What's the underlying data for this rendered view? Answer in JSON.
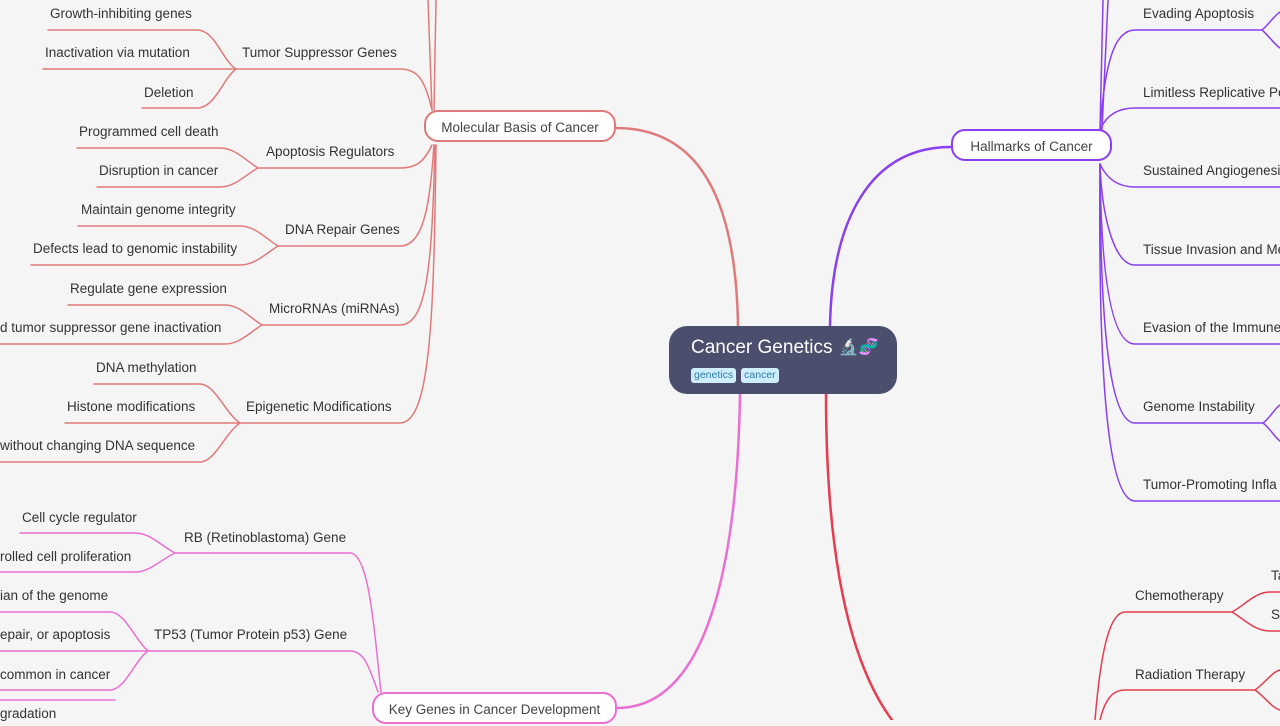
{
  "root": {
    "title": "Cancer Genetics",
    "emoji": "🔬🧬",
    "tags": [
      "genetics",
      "cancer"
    ]
  },
  "colors": {
    "background": "#f5f5f5",
    "root_fill": "#4b4e6d",
    "molecular": "#e07a7a",
    "hallmarks": "#8a3ff0",
    "key_genes": "#ea6fd3",
    "treatment": "#e63c4e",
    "tag_bg": "#cdeefa",
    "tag_text": "#2d7ea3"
  },
  "branches": {
    "molecular": {
      "label": "Molecular Basis of Cancer",
      "children": [
        {
          "label": "Tumor Suppressor Genes",
          "children": [
            "Growth-inhibiting genes",
            "Inactivation via mutation",
            "Deletion"
          ]
        },
        {
          "label": "Apoptosis Regulators",
          "children": [
            "Programmed cell death",
            "Disruption in cancer"
          ]
        },
        {
          "label": "DNA Repair Genes",
          "children": [
            "Maintain genome integrity",
            "Defects lead to genomic instability"
          ]
        },
        {
          "label": "MicroRNAs (miRNAs)",
          "children": [
            "Regulate gene expression",
            "d tumor suppressor gene inactivation"
          ]
        },
        {
          "label": "Epigenetic Modifications",
          "children": [
            "DNA methylation",
            "Histone modifications",
            "without changing DNA sequence"
          ]
        }
      ]
    },
    "hallmarks": {
      "label": "Hallmarks of Cancer",
      "children": [
        "Evading Apoptosis",
        "Limitless Replicative Po",
        "Sustained Angiogenesis",
        "Tissue Invasion and Me",
        "Evasion of the Immune",
        "Genome Instability",
        "Tumor-Promoting Infla"
      ]
    },
    "key_genes": {
      "label": "Key Genes in Cancer Development",
      "children": [
        {
          "label": "RB (Retinoblastoma) Gene",
          "children": [
            "Cell cycle regulator",
            "rolled cell proliferation"
          ]
        },
        {
          "label": "TP53 (Tumor Protein p53) Gene",
          "children": [
            "ian of the genome",
            "epair, or apoptosis",
            "common in cancer"
          ]
        },
        {
          "label": "",
          "children": [
            "gradation"
          ]
        }
      ]
    },
    "treatment": {
      "children": [
        {
          "label": "Chemotherapy",
          "children": [
            "Ta",
            "Si"
          ]
        },
        {
          "label": "Radiation Therapy",
          "children": []
        }
      ]
    }
  }
}
